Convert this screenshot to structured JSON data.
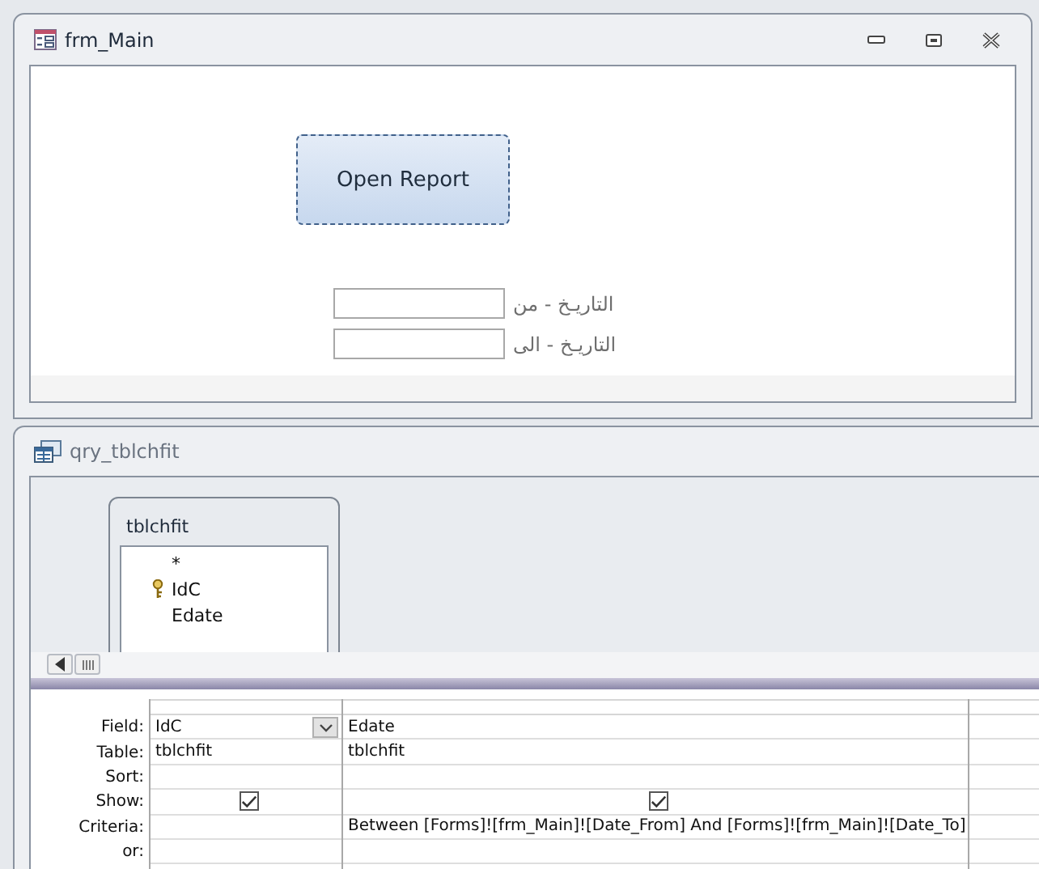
{
  "form_window": {
    "title": "frm_Main",
    "button": "Open Report",
    "fields": [
      {
        "label": "التاريـخ - من"
      },
      {
        "label": "التاريـخ - الى"
      }
    ]
  },
  "query_window": {
    "title": "qry_tblchfit",
    "table_box": {
      "title": "tblchfit",
      "fields": [
        {
          "name": "*",
          "primary_key": false
        },
        {
          "name": "IdC",
          "primary_key": true
        },
        {
          "name": "Edate",
          "primary_key": false
        }
      ]
    },
    "grid": {
      "row_labels": [
        "Field:",
        "Table:",
        "Sort:",
        "Show:",
        "Criteria:",
        "or:"
      ],
      "columns": [
        {
          "field": "IdC",
          "table": "tblchfit",
          "show": true,
          "dropdown": true
        },
        {
          "field": "Edate",
          "table": "tblchfit",
          "show": true,
          "dropdown": false,
          "criteria": "Between [Forms]![frm_Main]![Date_From] And [Forms]![frm_Main]![Date_To]"
        }
      ]
    }
  }
}
